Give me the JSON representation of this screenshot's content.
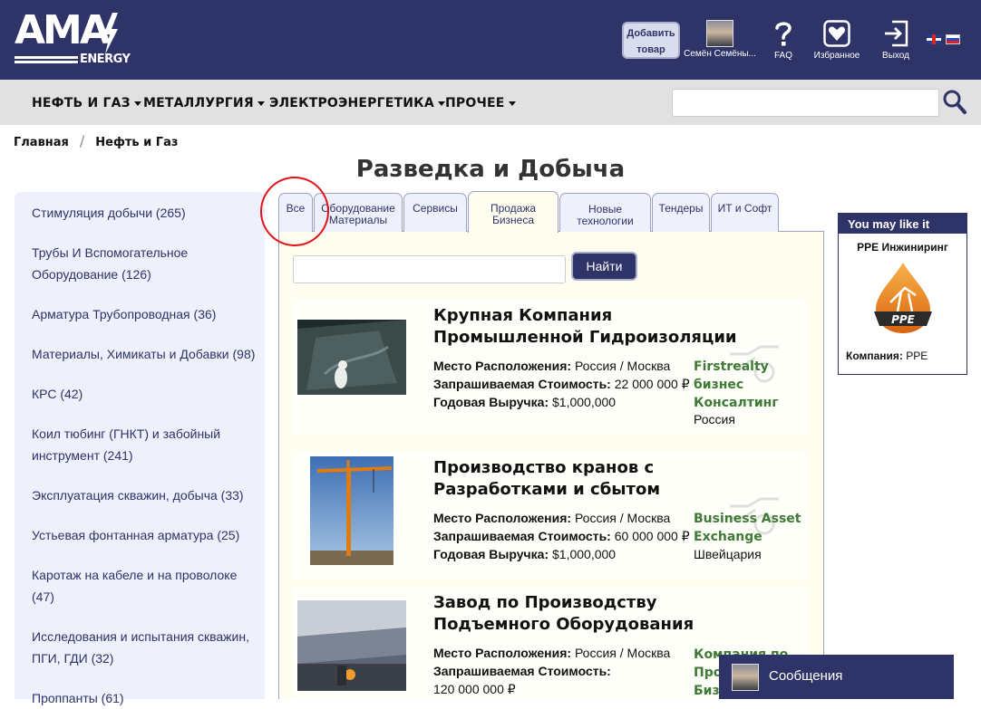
{
  "header": {
    "logo_text": "AMA",
    "logo_sub": "ENERGY",
    "add_product": "Добавить товар",
    "user_name": "Семён Семёны...",
    "faq_label": "FAQ",
    "favorites_label": "Избранное",
    "logout_label": "Выход"
  },
  "nav": {
    "items": [
      "НЕФТЬ И ГАЗ",
      "МЕТАЛЛУРГИЯ",
      "ЭЛЕКТРОЭНЕРГЕТИКА",
      "ПРОЧЕЕ"
    ],
    "search_value": ""
  },
  "breadcrumb": [
    "Главная",
    "Нефть и Газ"
  ],
  "page_title": "Разведка и Добыча",
  "sidebar": {
    "items": [
      "Стимуляция добычи (265)",
      "Трубы И Вспомогательное Оборудование (126)",
      "Арматура Трубопроводная (36)",
      "Материалы, Химикаты и Добавки (98)",
      "КРС (42)",
      "Коил тюбинг (ГНКТ) и забойный инструмент (241)",
      "Эксплуатация скважин, добыча (33)",
      "Устьевая фонтанная арматура (25)",
      "Каротаж на кабеле и на проволоке (47)",
      "Исследования и испытания скважин, ПГИ, ГДИ (32)",
      "Проппанты (61)"
    ]
  },
  "tabs": [
    "Все",
    "Оборудование Материалы",
    "Сервисы",
    "Продажа Бизнеса",
    "Новые технологии",
    "Тендеры",
    "ИТ и Софт"
  ],
  "active_tab": "Продажа Бизнеса",
  "panel": {
    "search_value": "",
    "find_label": "Найти"
  },
  "field_labels": {
    "location": "Место Расположения:",
    "price": "Запрашиваемая Стоимость:",
    "revenue": "Годовая Выручка:"
  },
  "listings": [
    {
      "title": "Крупная Компания Промышленной Гидроизоляции",
      "location": "Россия / Москва",
      "price": "22 000 000 ₽",
      "revenue": "$1,000,000",
      "seller": "Firstrealty бизнес Консалтинг",
      "country": "Россия"
    },
    {
      "title": "Производство кранов с Разработками и сбытом",
      "location": "Россия / Москва",
      "price": "60 000 000 ₽",
      "revenue": "$1,000,000",
      "seller": "Business Asset Exchange",
      "country": "Швейцария"
    },
    {
      "title": "Завод по Производству Подъемного Оборудования",
      "location": "Россия / Москва",
      "price": "120 000 000 ₽",
      "seller_partial": [
        "Компания по",
        "Про",
        "Биз"
      ]
    }
  ],
  "ad": {
    "heading": "You may like it",
    "name": "PPE Инжиниринг",
    "logo_text": "PPE",
    "company_label": "Компания:",
    "company_value": "PPE"
  },
  "messages_label": "Сообщения",
  "colors": {
    "brand_navy": "#2e3368",
    "nav_gray": "#e1e1e1",
    "sidebar_bg": "#eef0fb",
    "panel_bg": "#fffdef",
    "seller_green": "#3f7a36",
    "annotation_red": "#e0141b"
  },
  "icons": [
    "question-icon",
    "heart-icon",
    "logout-icon",
    "search-icon",
    "handshake-gear-icon"
  ]
}
